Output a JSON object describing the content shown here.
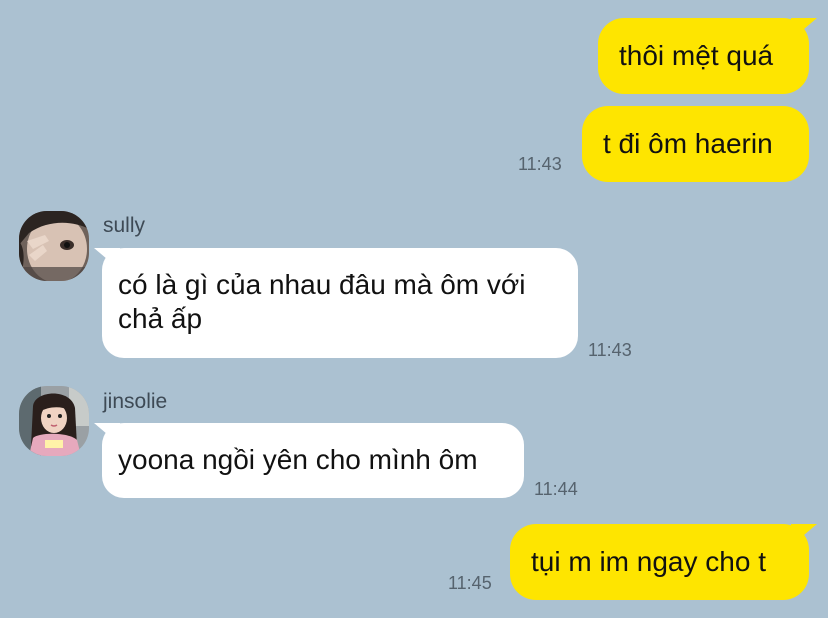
{
  "messages": [
    {
      "direction": "out",
      "text": "thôi mệt quá"
    },
    {
      "direction": "out",
      "text": "t đi ôm haerin",
      "time": "11:43"
    },
    {
      "direction": "in",
      "sender": "sully",
      "avatar_icon": "profile-photo-avatar",
      "text_line1": "có là gì của nhau đâu mà ôm với",
      "text_line2": "chả ấp",
      "time": "11:43"
    },
    {
      "direction": "in",
      "sender": "jinsolie",
      "avatar_icon": "profile-photo-avatar",
      "text": "yoona ngồi yên cho mình ôm",
      "time": "11:44"
    },
    {
      "direction": "out",
      "text": "tụi m im ngay cho t",
      "time": "11:45"
    }
  ],
  "colors": {
    "background": "#abc1d1",
    "outgoing_bubble": "#fee500",
    "incoming_bubble": "#ffffff"
  }
}
